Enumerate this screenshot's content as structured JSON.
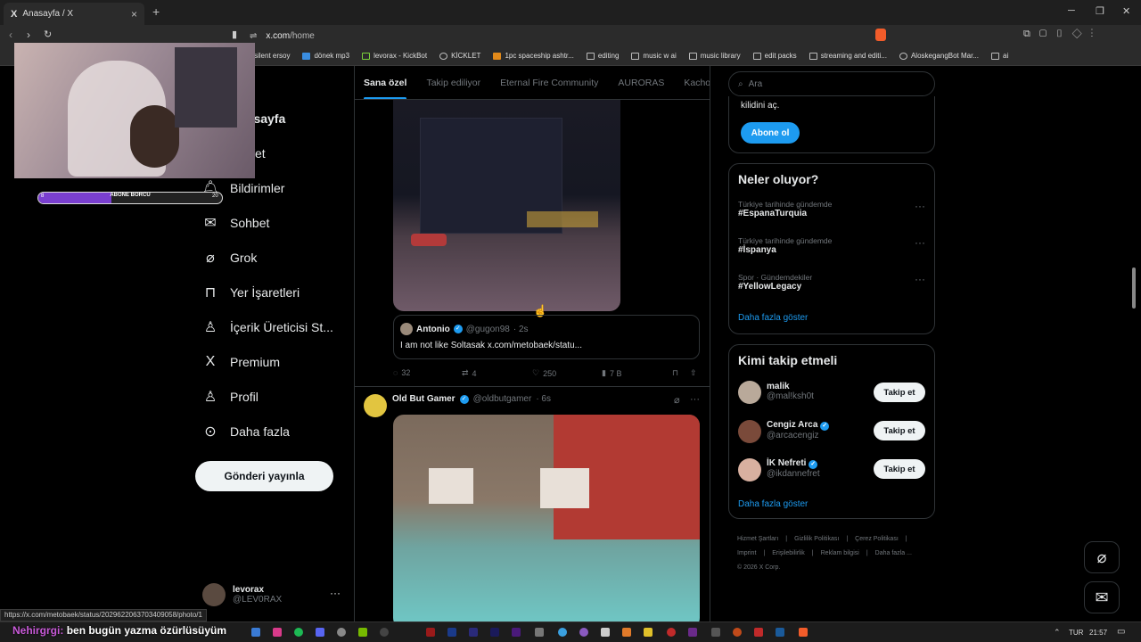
{
  "browser": {
    "tab_title": "Anasayfa / X",
    "url_domain": "x.com",
    "url_path": "/home",
    "bookmarks": [
      "silent ersoy",
      "dönek mp3",
      "levorax - KickBot",
      "KİCKLET",
      "1pc spaceship ashtr...",
      "editing",
      "music w ai",
      "music library",
      "edit packs",
      "streaming and editi...",
      "AloskegangBot Mar...",
      "ai"
    ],
    "status_url": "https://x.com/metobaek/status/2029622063703409058/photo/1"
  },
  "nav": {
    "items": [
      {
        "label": "Anasayfa",
        "icon": "home-icon"
      },
      {
        "label": "Keşfet",
        "icon": "search-icon"
      },
      {
        "label": "Bildirimler",
        "icon": "bell-icon"
      },
      {
        "label": "Sohbet",
        "icon": "mail-icon"
      },
      {
        "label": "Grok",
        "icon": "grok-icon"
      },
      {
        "label": "Yer İşaretleri",
        "icon": "bookmark-icon"
      },
      {
        "label": "İçerik Üreticisi St...",
        "icon": "creator-icon"
      },
      {
        "label": "Premium",
        "icon": "x-logo-icon"
      },
      {
        "label": "Profil",
        "icon": "person-icon"
      },
      {
        "label": "Daha fazla",
        "icon": "more-circle-icon"
      }
    ],
    "post_button": "Gönderi yayınla",
    "account_name": "levorax",
    "account_handle": "@LEV0RAX"
  },
  "feed": {
    "tabs": [
      "Sana özel",
      "Takip ediliyor",
      "Eternal Fire Community",
      "AURORAS",
      "Kachow"
    ],
    "quote": {
      "name": "Antonio",
      "handle": "@gugon98",
      "time": "· 2s",
      "text": "I am not like Soltasak x.com/metobaek/statu..."
    },
    "actions": {
      "replies": "32",
      "reposts": "4",
      "likes": "250",
      "views": "7 B"
    },
    "post2": {
      "name": "Old But Gamer",
      "handle": "@oldbutgamer",
      "time": "· 6s"
    }
  },
  "right": {
    "search_placeholder": "Ara",
    "subscribe_text": "kilidini aç.",
    "subscribe_button": "Abone ol",
    "trends_title": "Neler oluyor?",
    "trends": [
      {
        "meta": "Türkiye tarihinde gündemde",
        "tag": "#EspanaTurquia"
      },
      {
        "meta": "Türkiye tarihinde gündemde",
        "tag": "#İspanya"
      },
      {
        "meta": "Spor · Gündemdekiler",
        "tag": "#YellowLegacy"
      }
    ],
    "trends_more": "Daha fazla göster",
    "who_title": "Kimi takip etmeli",
    "who": [
      {
        "name": "malik",
        "handle": "@mal!ksh0t",
        "verified": false,
        "avatar_color": "#b9a99a"
      },
      {
        "name": "Cengiz Arca",
        "handle": "@arcacengiz",
        "verified": true,
        "avatar_color": "#7a4a3a"
      },
      {
        "name": "İK Nefreti",
        "handle": "@ikdannefret",
        "verified": true,
        "avatar_color": "#d8b0a0"
      }
    ],
    "follow_label": "Takip et",
    "who_more": "Daha fazla göster",
    "footer": {
      "line1": [
        "Hizmet Şartları",
        "|",
        "Gizlilik Politikası",
        "|",
        "Çerez Politikası",
        "|"
      ],
      "line2": [
        "Imprint",
        "|",
        "Erişilebilirlik",
        "|",
        "Reklam bilgisi",
        "|",
        "Daha fazla ..."
      ],
      "copyright": "© 2026 X Corp."
    }
  },
  "stream": {
    "progress_label": "ABONE BORCU",
    "progress_left": "8",
    "progress_right": "20",
    "progress_fraction": 0.4,
    "overlay_user": "Nehirgrgi:",
    "overlay_text": "ben bugün yazma özürlüsüyüm"
  },
  "taskbar": {
    "lang": "TUR",
    "time": "21:57"
  },
  "colors": {
    "accent": "#1d9bf0",
    "background": "#000000",
    "border": "#2f3336",
    "muted": "#71767b"
  }
}
